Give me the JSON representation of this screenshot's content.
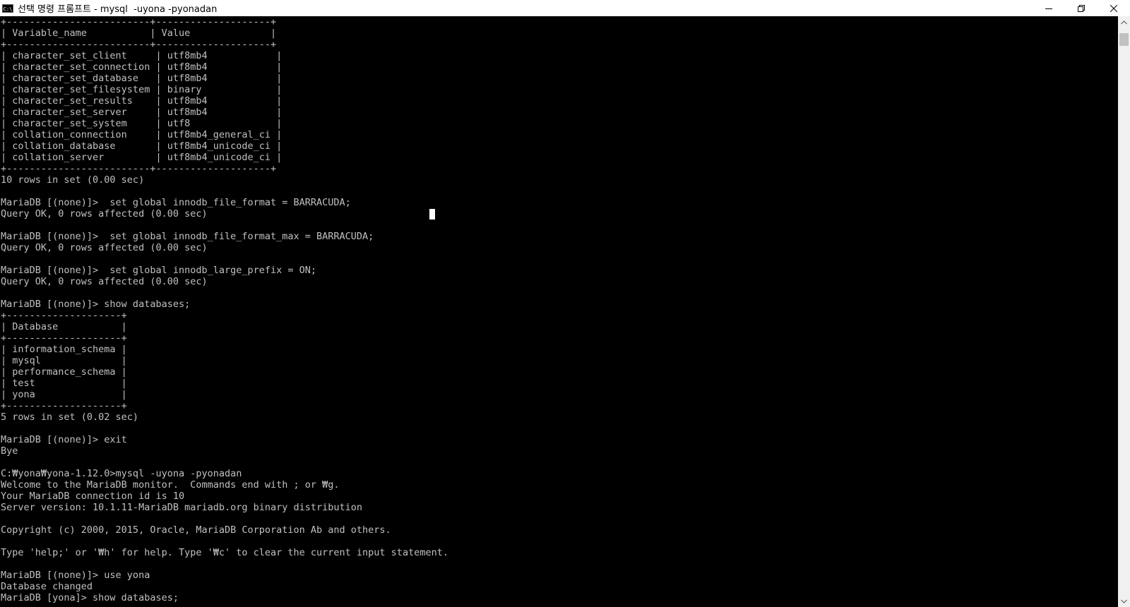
{
  "window": {
    "title": "선택 명령 프롬프트 - mysql  -uyona -pyonadan",
    "icon": "cmd-icon",
    "icon_text": "C:\\"
  },
  "console": {
    "lines": [
      "+-------------------------+--------------------+",
      "| Variable_name           | Value              |",
      "+-------------------------+--------------------+",
      "| character_set_client     | utf8mb4            |",
      "| character_set_connection | utf8mb4            |",
      "| character_set_database   | utf8mb4            |",
      "| character_set_filesystem | binary             |",
      "| character_set_results    | utf8mb4            |",
      "| character_set_server     | utf8mb4            |",
      "| character_set_system     | utf8               |",
      "| collation_connection     | utf8mb4_general_ci |",
      "| collation_database       | utf8mb4_unicode_ci |",
      "| collation_server         | utf8mb4_unicode_ci |",
      "+-------------------------+--------------------+",
      "10 rows in set (0.00 sec)",
      "",
      "MariaDB [(none)]>  set global innodb_file_format = BARRACUDA;",
      "Query OK, 0 rows affected (0.00 sec)",
      "",
      "MariaDB [(none)]>  set global innodb_file_format_max = BARRACUDA;",
      "Query OK, 0 rows affected (0.00 sec)",
      "",
      "MariaDB [(none)]>  set global innodb_large_prefix = ON;",
      "Query OK, 0 rows affected (0.00 sec)",
      "",
      "MariaDB [(none)]> show databases;",
      "+--------------------+",
      "| Database           |",
      "+--------------------+",
      "| information_schema |",
      "| mysql              |",
      "| performance_schema |",
      "| test               |",
      "| yona               |",
      "+--------------------+",
      "5 rows in set (0.02 sec)",
      "",
      "MariaDB [(none)]> exit",
      "Bye",
      "",
      "C:₩yona₩yona-1.12.0>mysql -uyona -pyonadan",
      "Welcome to the MariaDB monitor.  Commands end with ; or ₩g.",
      "Your MariaDB connection id is 10",
      "Server version: 10.1.11-MariaDB mariadb.org binary distribution",
      "",
      "Copyright (c) 2000, 2015, Oracle, MariaDB Corporation Ab and others.",
      "",
      "Type 'help;' or '₩h' for help. Type '₩c' to clear the current input statement.",
      "",
      "MariaDB [(none)]> use yona",
      "Database changed",
      "MariaDB [yona]> show databases;"
    ]
  },
  "colors": {
    "console_bg": "#000000",
    "console_fg": "#c0c0c0",
    "titlebar_bg": "#ffffff",
    "scrollbar_bg": "#f0f0f0",
    "scrollbar_thumb": "#c1c1c1"
  }
}
